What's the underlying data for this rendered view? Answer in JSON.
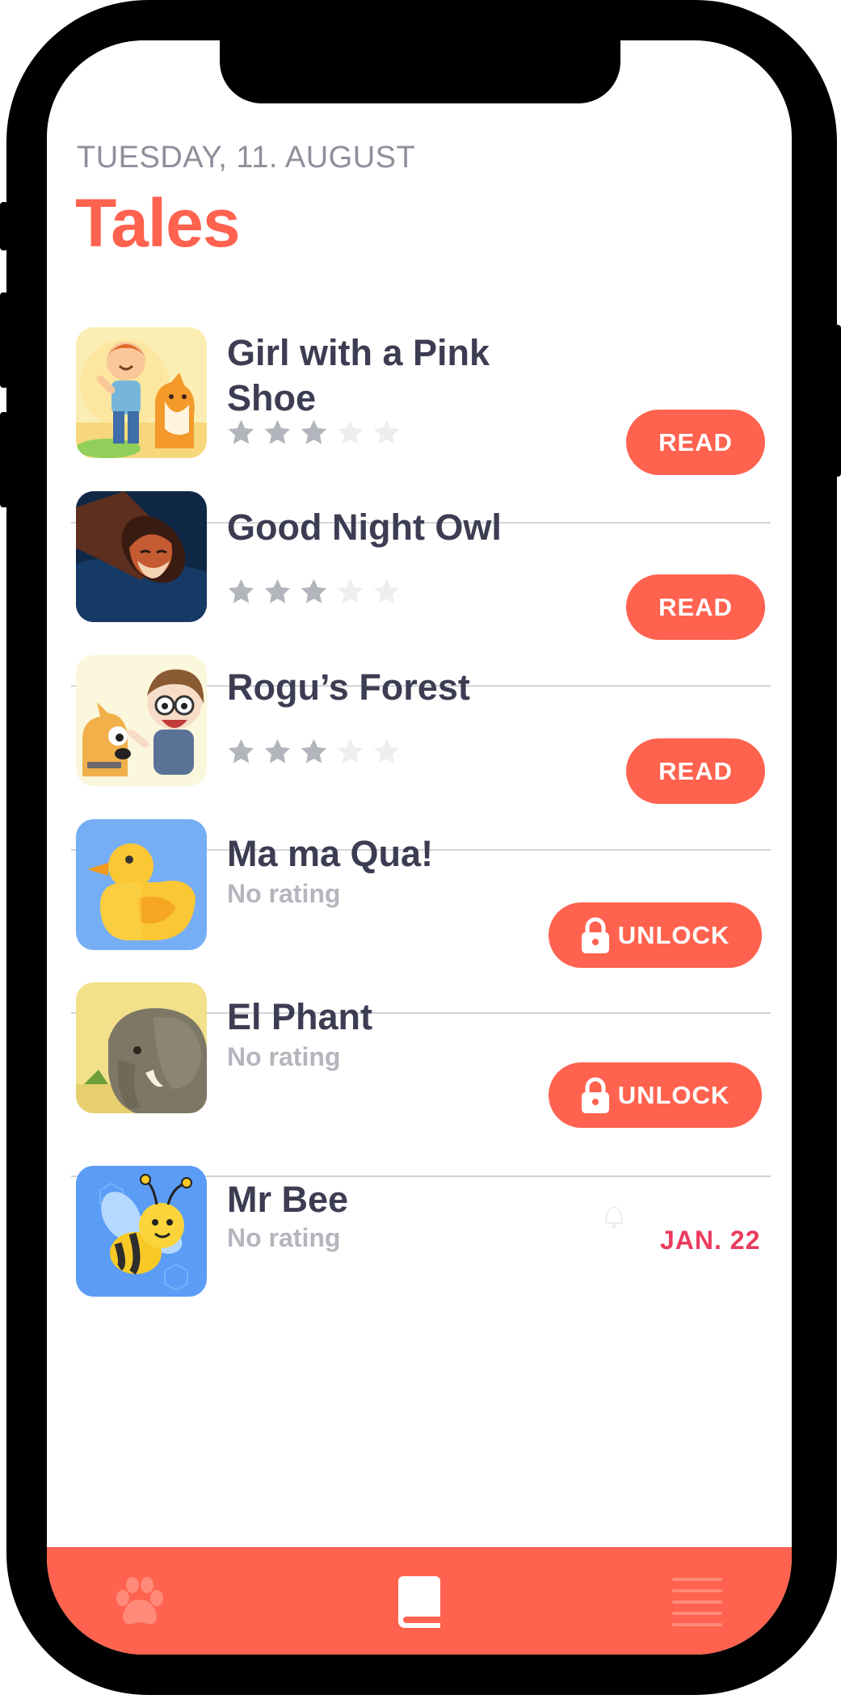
{
  "header": {
    "date": "TUESDAY, 11. AUGUST",
    "title": "Tales"
  },
  "colors": {
    "accent": "#ff624f",
    "date_badge": "#ea3b5e",
    "title_text": "#3c3d52",
    "muted_text": "#b5b6bd",
    "star_filled": "#b3b5bd",
    "star_empty": "#eeeef1"
  },
  "tales": [
    {
      "name": "Girl with a Pink Shoe",
      "rating": 3,
      "max_rating": 5,
      "action": "READ",
      "thumb_icon": "boy-and-dog-illustration"
    },
    {
      "name": "Good Night Owl",
      "rating": 3,
      "max_rating": 5,
      "action": "READ",
      "thumb_icon": "fox-in-log-illustration"
    },
    {
      "name": "Rogu’s Forest",
      "rating": 3,
      "max_rating": 5,
      "action": "READ",
      "thumb_icon": "kid-and-dog-illustration"
    },
    {
      "name": "Ma ma Qua!",
      "rating_text": "No rating",
      "action": "UNLOCK",
      "thumb_icon": "duck-illustration"
    },
    {
      "name": "El Phant",
      "rating_text": "No rating",
      "action": "UNLOCK",
      "thumb_icon": "elephant-illustration"
    },
    {
      "name": "Mr Bee",
      "rating_text": "No rating",
      "release": "JAN. 22",
      "thumb_icon": "bee-illustration"
    }
  ],
  "tabbar": {
    "items": [
      {
        "icon": "paw-icon",
        "active": false
      },
      {
        "icon": "book-icon",
        "active": true
      },
      {
        "icon": "menu-icon",
        "active": false
      }
    ]
  }
}
